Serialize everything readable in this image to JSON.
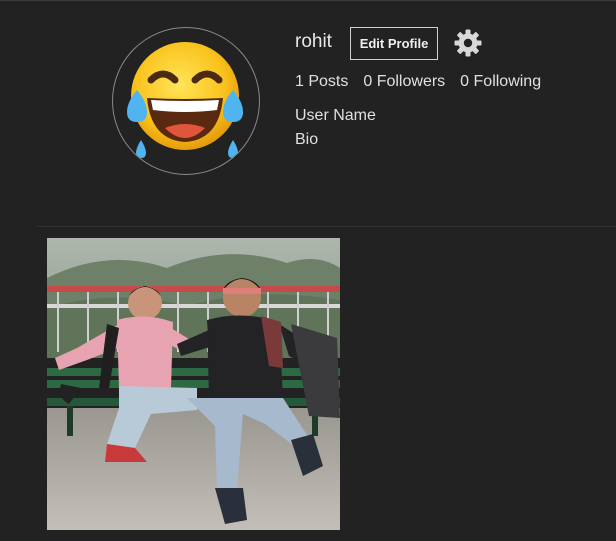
{
  "profile": {
    "username": "rohit",
    "edit_label": "Edit Profile",
    "real_name": "User Name",
    "bio": "Bio",
    "avatar_icon": "laughing-tears-emoji"
  },
  "stats": {
    "posts": "1 Posts",
    "followers": "0 Followers",
    "following": "0 Following"
  },
  "settings_icon": "gear-icon",
  "posts": [
    {
      "kind": "photo",
      "subject": "two-friends-on-bench"
    }
  ],
  "colors": {
    "background": "#222222",
    "text": "#e6e6e6",
    "border": "#d0d0d0"
  }
}
